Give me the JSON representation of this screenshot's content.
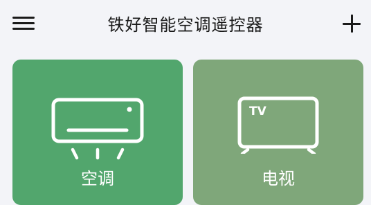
{
  "header": {
    "title": "铁好智能空调遥控器"
  },
  "devices": [
    {
      "label": "空调",
      "icon": "air-conditioner-icon",
      "color": "#52a66d"
    },
    {
      "label": "电视",
      "icon": "tv-icon",
      "icon_text": "TV",
      "color": "#7fa77a"
    }
  ]
}
